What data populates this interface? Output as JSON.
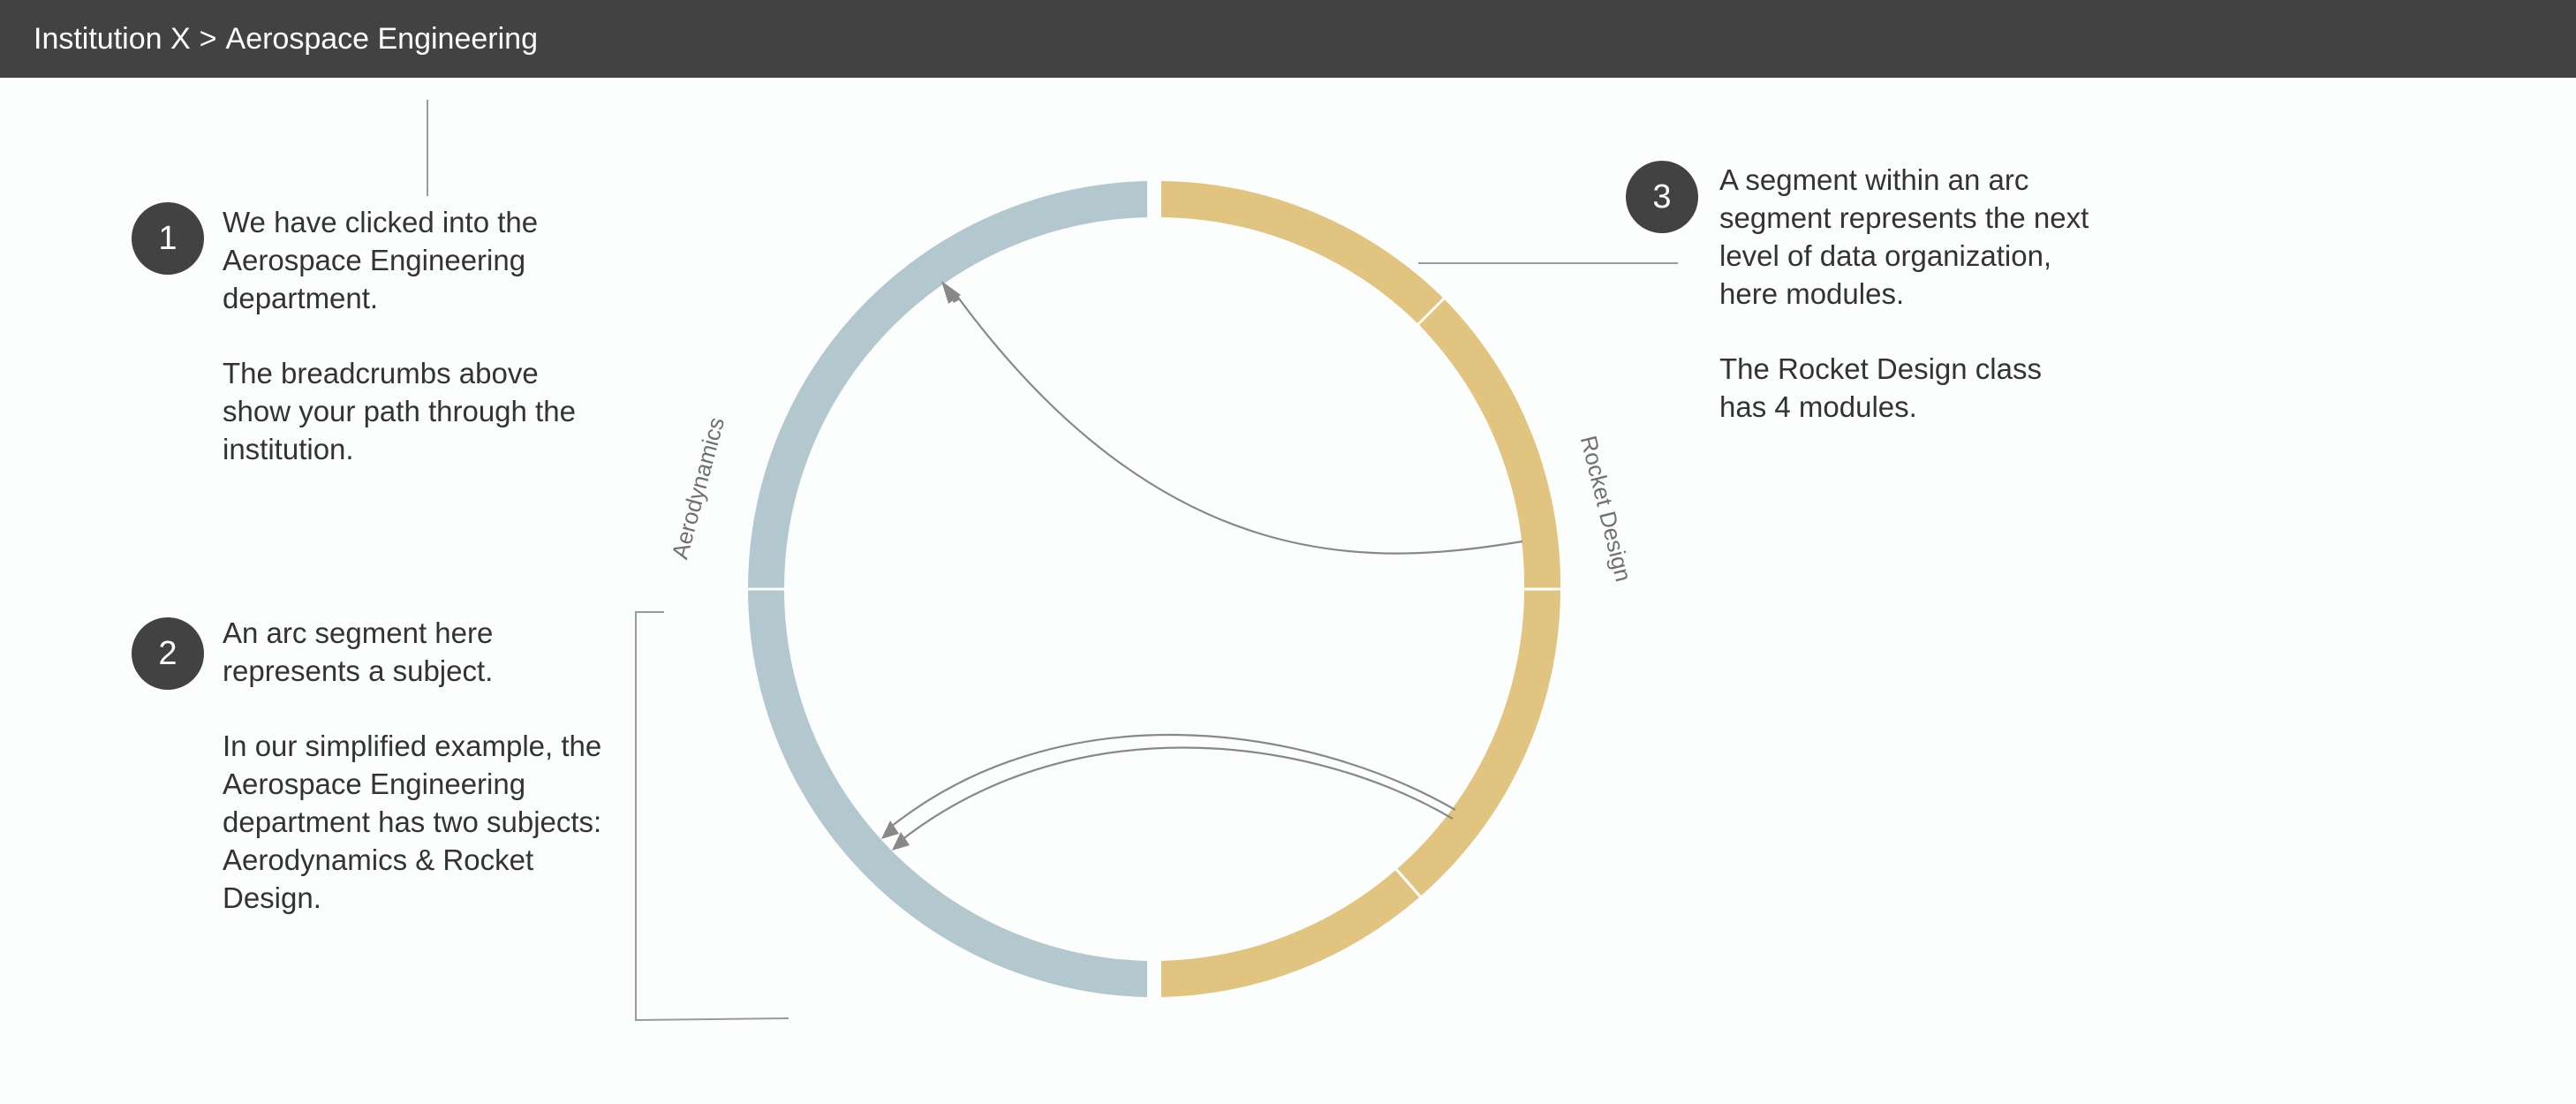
{
  "header": {
    "crumbs": [
      "Institution X",
      "Aerospace Engineering"
    ],
    "separator": ">"
  },
  "annotations": [
    {
      "number": "1",
      "paragraphs": [
        "We have clicked into the Aerospace Engineering department.",
        "The breadcrumbs above show your path through the institution."
      ]
    },
    {
      "number": "2",
      "paragraphs": [
        "An arc segment here represents a subject.",
        "In our simplified example, the Aerospace Engineering department has two subjects: Aerodynamics & Rocket Design."
      ]
    },
    {
      "number": "3",
      "paragraphs": [
        "A segment within an arc segment represents the next level of data organization, here modules.",
        "The Rocket Design class has 4 modules."
      ]
    }
  ],
  "chord_diagram": {
    "subjects": [
      {
        "name": "Aerodynamics",
        "color": "#b2c7ce",
        "modules": 2
      },
      {
        "name": "Rocket Design",
        "color": "#e0c47f",
        "modules": 4
      }
    ],
    "line_color": "#888888"
  }
}
